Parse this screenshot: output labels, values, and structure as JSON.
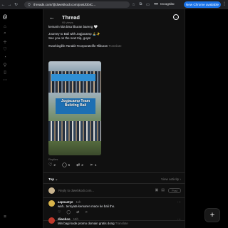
{
  "browser": {
    "url": "threads.com/@diwebkodi.com/post/DbIC...",
    "incognito_label": "Incognito",
    "update_label": "New Chrome available",
    "back": "←",
    "forward": "→",
    "reload": "↻",
    "more": "⋮"
  },
  "rail": {
    "icons": [
      "threads-logo-icon",
      "home-icon",
      "search-icon",
      "add-icon",
      "heart-icon",
      "profile-icon",
      "pin-icon",
      "bookmark-icon",
      "menu-icon"
    ]
  },
  "header": {
    "back": "←",
    "title": "Thread",
    "views": "95 views",
    "more": "⋯"
  },
  "post": {
    "line1": "kemarin kita bisa liburan bareng 🤍",
    "line2": "Journey to Bali with Jogjacamp 🏝️✨",
    "line3": "See you on the next trip, guys!",
    "hashtags": "#workinglife #anakit #corporatelife #liburan",
    "translate": "Translate",
    "image_caption": "Jogjacamp Team Building Bali",
    "replies_label": "Replies"
  },
  "actions": {
    "like": "2",
    "comment": "5",
    "repost": "2",
    "share": "1"
  },
  "sort": {
    "label": "Top",
    "view_activity": "View activity ›"
  },
  "composer": {
    "placeholder": "Reply to diwebkodi.com..."
  },
  "comments": [
    {
      "user": "aspnastye",
      "time": "11h",
      "text": "wah.. ternyata kemaren mace ke bali tho.",
      "translate": "",
      "avatar_color": "#d9b44a"
    },
    {
      "user": "diwebco",
      "time": "15h",
      "text": "Min bagi kode promo domain gratis dong",
      "translate": "Translate",
      "avatar_color": "#c0392b"
    }
  ],
  "fab": "+"
}
